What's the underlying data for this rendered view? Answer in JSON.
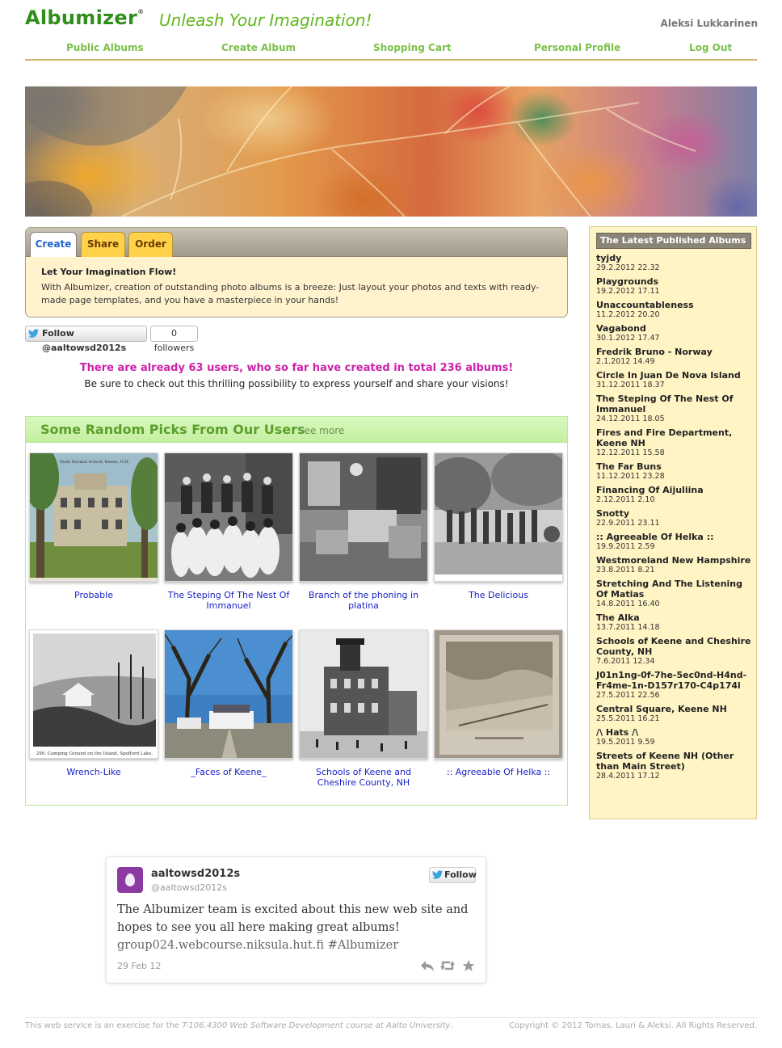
{
  "header": {
    "logo": "Albumizer",
    "logo_mark": "®",
    "slogan": "Unleash Your Imagination!",
    "user_name": "Aleksi Lukkarinen"
  },
  "nav": {
    "public_albums": "Public Albums",
    "create_album": "Create Album",
    "shopping_cart": "Shopping Cart",
    "personal_profile": "Personal Profile",
    "log_out": "Log Out"
  },
  "tabs": {
    "create": "Create",
    "share": "Share",
    "order": "Order",
    "heading": "Let Your Imagination Flow!",
    "text": "With Albumizer, creation of outstanding photo albums is a breeze: Just layout your photos and texts with ready-made page templates, and you have a masterpiece in your hands!"
  },
  "twitter_button": {
    "label": "Follow @aaltowsd2012s",
    "followers": "0 followers"
  },
  "stats": {
    "headline": "There are already 63 users, who so far have created in total 236 albums!",
    "sub": "Be sure to check out this thrilling possibility to express yourself and share your visions!"
  },
  "picks": {
    "title": "Some Random Picks From Our Users",
    "see_more": "See more",
    "items": [
      {
        "caption": "Probable"
      },
      {
        "caption": "The Steping Of The Nest Of Immanuel"
      },
      {
        "caption": "Branch of the phoning in platina"
      },
      {
        "caption": "The Delicious"
      },
      {
        "caption": "Wrench-Like"
      },
      {
        "caption": "_Faces of Keene_"
      },
      {
        "caption": "Schools of Keene and Cheshire County, NH"
      },
      {
        "caption": ":: Agreeable Of Helka ::"
      }
    ],
    "photo_texts": {
      "school_sign": "State Normal School, Keene, N.H.",
      "camping_caption": "290. Camping Ground on the Island, Spofford Lake."
    }
  },
  "sidebar": {
    "title": "The Latest Published Albums",
    "albums": [
      {
        "name": "tyjdy",
        "date": "29.2.2012 22.32"
      },
      {
        "name": "Playgrounds",
        "date": "19.2.2012 17.11"
      },
      {
        "name": "Unaccountableness",
        "date": "11.2.2012 20.20"
      },
      {
        "name": "Vagabond",
        "date": "30.1.2012 17.47"
      },
      {
        "name": "Fredrik Bruno - Norway",
        "date": "2.1.2012 14.49"
      },
      {
        "name": "Circle In Juan De Nova Island",
        "date": "31.12.2011 18.37"
      },
      {
        "name": "The Steping Of The Nest Of Immanuel",
        "date": "24.12.2011 18.05"
      },
      {
        "name": "Fires and Fire Department, Keene NH",
        "date": "12.12.2011 15.58"
      },
      {
        "name": "The Far Buns",
        "date": "11.12.2011 23.28"
      },
      {
        "name": "Financing Of Aijuliina",
        "date": "2.12.2011 2.10"
      },
      {
        "name": "Snotty",
        "date": "22.9.2011 23.11"
      },
      {
        "name": ":: Agreeable Of Helka ::",
        "date": "19.9.2011 2.59"
      },
      {
        "name": "Westmoreland New Hampshire",
        "date": "23.8.2011 8.21"
      },
      {
        "name": "Stretching And The Listening Of Matias",
        "date": "14.8.2011 16.40"
      },
      {
        "name": "The Alka",
        "date": "13.7.2011 14.18"
      },
      {
        "name": "Schools of Keene and Cheshire County, NH",
        "date": "7.6.2011 12.34"
      },
      {
        "name": "J01n1ng-0f-7he-5ec0nd-H4nd-Fr4me-1n-D157r170-C4p174l",
        "date": "27.5.2011 22.56"
      },
      {
        "name": "Central Square, Keene NH",
        "date": "25.5.2011 16.21"
      },
      {
        "name": "/\\ Hats /\\",
        "date": "19.5.2011 9.59"
      },
      {
        "name": "Streets of Keene NH (Other than Main Street)",
        "date": "28.4.2011 17.12"
      }
    ]
  },
  "tweet": {
    "name": "aaltowsd2012s",
    "handle": "@aaltowsd2012s",
    "follow": "Follow",
    "text": "The Albumizer team is excited about this new web site and hopes to see you all here making great albums!",
    "link": "group024.webcourse.niksula.hut.fi #Albumizer",
    "date": "29 Feb 12"
  },
  "footer": {
    "left_prefix": "This web service is an exercise for the ",
    "course": "T-106.4300 Web Software Development course at Aalto University",
    "left_suffix": ".",
    "right": "Copyright © 2012 Tomas, Lauri & Aleksi. All Rights Reserved."
  },
  "colors": {
    "brand_green": "#2f8f1a",
    "nav_green": "#7cc04b",
    "sidebar_bg": "#fff4c4",
    "stats_magenta": "#cc22aa",
    "link_blue": "#1a22c8"
  }
}
